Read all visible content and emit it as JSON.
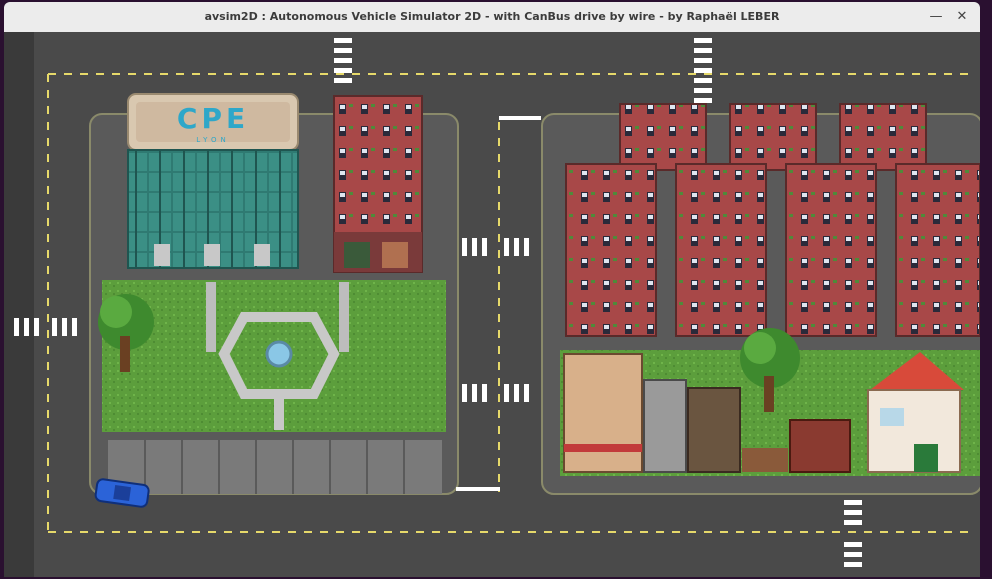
{
  "window": {
    "title": "avsim2D : Autonomous Vehicle Simulator 2D - with CanBus drive by wire - by Raphaël LEBER",
    "min_glyph": "—",
    "close_glyph": "✕"
  },
  "scene": {
    "logo_top": "CPE",
    "logo_bottom": "LYON",
    "colors": {
      "road": "#4a4a4a",
      "lane_marking": "#e6d96a",
      "grass": "#5c9e3c",
      "brick": "#a84848",
      "car": "#2b63d8",
      "glass": "#2f7a72"
    }
  }
}
